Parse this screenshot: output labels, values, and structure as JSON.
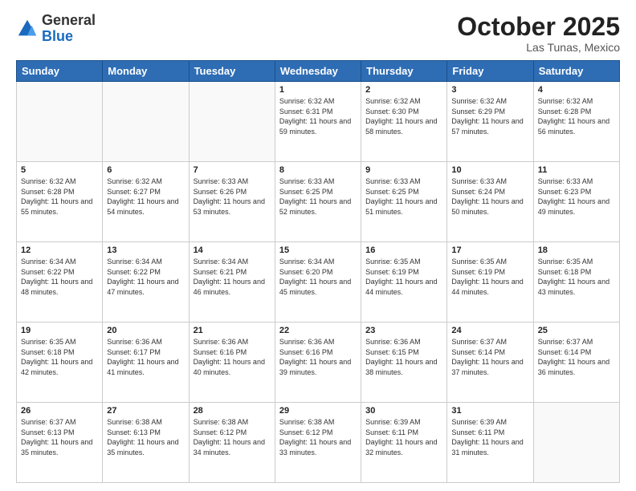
{
  "header": {
    "logo_general": "General",
    "logo_blue": "Blue",
    "month": "October 2025",
    "location": "Las Tunas, Mexico"
  },
  "days_of_week": [
    "Sunday",
    "Monday",
    "Tuesday",
    "Wednesday",
    "Thursday",
    "Friday",
    "Saturday"
  ],
  "weeks": [
    [
      {
        "day": "",
        "info": ""
      },
      {
        "day": "",
        "info": ""
      },
      {
        "day": "",
        "info": ""
      },
      {
        "day": "1",
        "info": "Sunrise: 6:32 AM\nSunset: 6:31 PM\nDaylight: 11 hours\nand 59 minutes."
      },
      {
        "day": "2",
        "info": "Sunrise: 6:32 AM\nSunset: 6:30 PM\nDaylight: 11 hours\nand 58 minutes."
      },
      {
        "day": "3",
        "info": "Sunrise: 6:32 AM\nSunset: 6:29 PM\nDaylight: 11 hours\nand 57 minutes."
      },
      {
        "day": "4",
        "info": "Sunrise: 6:32 AM\nSunset: 6:28 PM\nDaylight: 11 hours\nand 56 minutes."
      }
    ],
    [
      {
        "day": "5",
        "info": "Sunrise: 6:32 AM\nSunset: 6:28 PM\nDaylight: 11 hours\nand 55 minutes."
      },
      {
        "day": "6",
        "info": "Sunrise: 6:32 AM\nSunset: 6:27 PM\nDaylight: 11 hours\nand 54 minutes."
      },
      {
        "day": "7",
        "info": "Sunrise: 6:33 AM\nSunset: 6:26 PM\nDaylight: 11 hours\nand 53 minutes."
      },
      {
        "day": "8",
        "info": "Sunrise: 6:33 AM\nSunset: 6:25 PM\nDaylight: 11 hours\nand 52 minutes."
      },
      {
        "day": "9",
        "info": "Sunrise: 6:33 AM\nSunset: 6:25 PM\nDaylight: 11 hours\nand 51 minutes."
      },
      {
        "day": "10",
        "info": "Sunrise: 6:33 AM\nSunset: 6:24 PM\nDaylight: 11 hours\nand 50 minutes."
      },
      {
        "day": "11",
        "info": "Sunrise: 6:33 AM\nSunset: 6:23 PM\nDaylight: 11 hours\nand 49 minutes."
      }
    ],
    [
      {
        "day": "12",
        "info": "Sunrise: 6:34 AM\nSunset: 6:22 PM\nDaylight: 11 hours\nand 48 minutes."
      },
      {
        "day": "13",
        "info": "Sunrise: 6:34 AM\nSunset: 6:22 PM\nDaylight: 11 hours\nand 47 minutes."
      },
      {
        "day": "14",
        "info": "Sunrise: 6:34 AM\nSunset: 6:21 PM\nDaylight: 11 hours\nand 46 minutes."
      },
      {
        "day": "15",
        "info": "Sunrise: 6:34 AM\nSunset: 6:20 PM\nDaylight: 11 hours\nand 45 minutes."
      },
      {
        "day": "16",
        "info": "Sunrise: 6:35 AM\nSunset: 6:19 PM\nDaylight: 11 hours\nand 44 minutes."
      },
      {
        "day": "17",
        "info": "Sunrise: 6:35 AM\nSunset: 6:19 PM\nDaylight: 11 hours\nand 44 minutes."
      },
      {
        "day": "18",
        "info": "Sunrise: 6:35 AM\nSunset: 6:18 PM\nDaylight: 11 hours\nand 43 minutes."
      }
    ],
    [
      {
        "day": "19",
        "info": "Sunrise: 6:35 AM\nSunset: 6:18 PM\nDaylight: 11 hours\nand 42 minutes."
      },
      {
        "day": "20",
        "info": "Sunrise: 6:36 AM\nSunset: 6:17 PM\nDaylight: 11 hours\nand 41 minutes."
      },
      {
        "day": "21",
        "info": "Sunrise: 6:36 AM\nSunset: 6:16 PM\nDaylight: 11 hours\nand 40 minutes."
      },
      {
        "day": "22",
        "info": "Sunrise: 6:36 AM\nSunset: 6:16 PM\nDaylight: 11 hours\nand 39 minutes."
      },
      {
        "day": "23",
        "info": "Sunrise: 6:36 AM\nSunset: 6:15 PM\nDaylight: 11 hours\nand 38 minutes."
      },
      {
        "day": "24",
        "info": "Sunrise: 6:37 AM\nSunset: 6:14 PM\nDaylight: 11 hours\nand 37 minutes."
      },
      {
        "day": "25",
        "info": "Sunrise: 6:37 AM\nSunset: 6:14 PM\nDaylight: 11 hours\nand 36 minutes."
      }
    ],
    [
      {
        "day": "26",
        "info": "Sunrise: 6:37 AM\nSunset: 6:13 PM\nDaylight: 11 hours\nand 35 minutes."
      },
      {
        "day": "27",
        "info": "Sunrise: 6:38 AM\nSunset: 6:13 PM\nDaylight: 11 hours\nand 35 minutes."
      },
      {
        "day": "28",
        "info": "Sunrise: 6:38 AM\nSunset: 6:12 PM\nDaylight: 11 hours\nand 34 minutes."
      },
      {
        "day": "29",
        "info": "Sunrise: 6:38 AM\nSunset: 6:12 PM\nDaylight: 11 hours\nand 33 minutes."
      },
      {
        "day": "30",
        "info": "Sunrise: 6:39 AM\nSunset: 6:11 PM\nDaylight: 11 hours\nand 32 minutes."
      },
      {
        "day": "31",
        "info": "Sunrise: 6:39 AM\nSunset: 6:11 PM\nDaylight: 11 hours\nand 31 minutes."
      },
      {
        "day": "",
        "info": ""
      }
    ]
  ]
}
